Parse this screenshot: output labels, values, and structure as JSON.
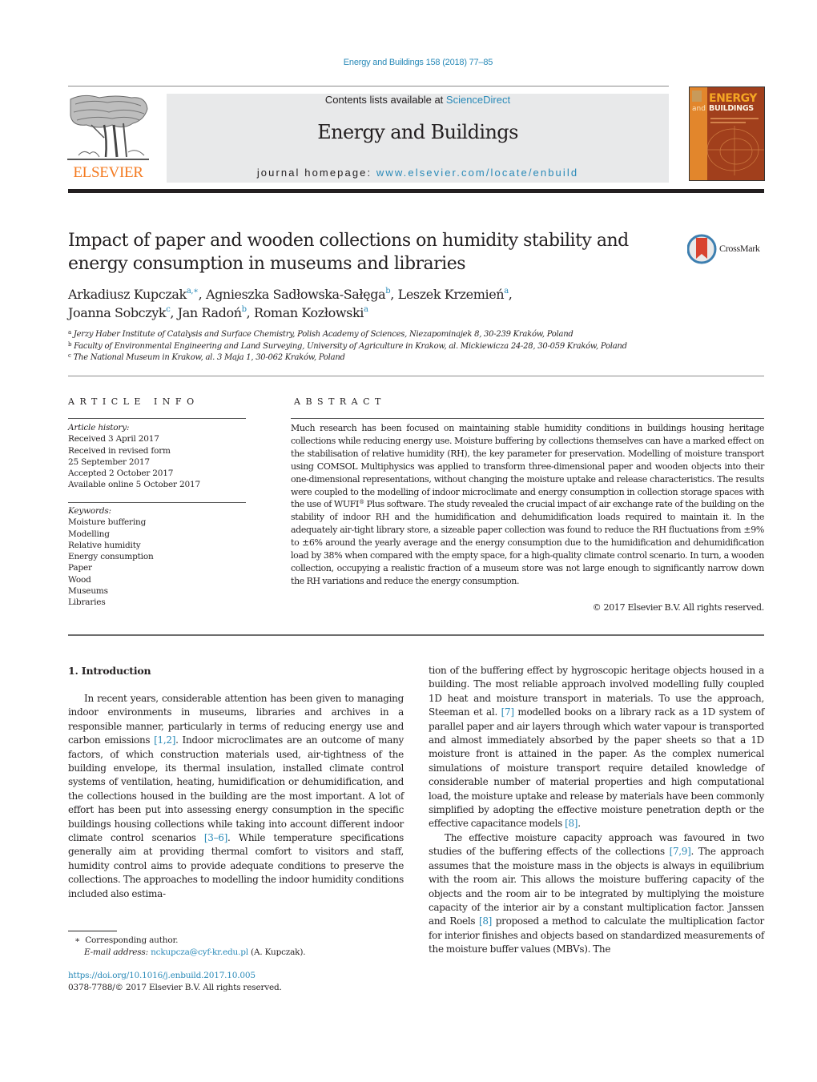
{
  "header": {
    "citation": "Energy and Buildings 158 (2018) 77–85",
    "contents_prefix": "Contents lists available at ",
    "contents_link": "ScienceDirect",
    "journal_name": "Energy and Buildings",
    "homepage_prefix": "journal homepage: ",
    "homepage_link": "www.elsevier.com/locate/enbuild",
    "publisher_wordmark": "ELSEVIER",
    "cover": {
      "line1": "ENERGY",
      "line2_prefix": "and",
      "line2": "BUILDINGS"
    },
    "crossmark_label": "CrossMark"
  },
  "article": {
    "title": "Impact of paper and wooden collections on humidity stability and energy consumption in museums and libraries",
    "authors": [
      {
        "name": "Arkadiusz Kupczak",
        "sup": "a,∗",
        "sep": ", "
      },
      {
        "name": "Agnieszka Sadłowska-Sałęga",
        "sup": "b",
        "sep": ", "
      },
      {
        "name": "Leszek Krzemień",
        "sup": "a",
        "sep": ","
      },
      {
        "name": "Joanna Sobczyk",
        "sup": "c",
        "sep": ", "
      },
      {
        "name": "Jan Radoń",
        "sup": "b",
        "sep": ", "
      },
      {
        "name": "Roman Kozłowski",
        "sup": "a",
        "sep": ""
      }
    ],
    "affiliations": [
      {
        "key": "a",
        "text": "Jerzy Haber Institute of Catalysis and Surface Chemistry, Polish Academy of Sciences, Niezapominajek 8, 30-239 Kraków, Poland"
      },
      {
        "key": "b",
        "text": "Faculty of Environmental Engineering and Land Surveying, University of Agriculture in Krakow, al. Mickiewicza 24-28, 30-059 Kraków, Poland"
      },
      {
        "key": "c",
        "text": "The National Museum in Krakow, al. 3 Maja 1, 30-062 Kraków, Poland"
      }
    ]
  },
  "article_info": {
    "heading": "ARTICLE INFO",
    "history_label": "Article history:",
    "history": [
      "Received 3 April 2017",
      "Received in revised form",
      "25 September 2017",
      "Accepted 2 October 2017",
      "Available online 5 October 2017"
    ],
    "keywords_label": "Keywords:",
    "keywords": [
      "Moisture buffering",
      "Modelling",
      "Relative humidity",
      "Energy consumption",
      "Paper",
      "Wood",
      "Museums",
      "Libraries"
    ]
  },
  "abstract": {
    "heading": "ABSTRACT",
    "text_before_sup": "Much research has been focused on maintaining stable humidity conditions in buildings housing heritage collections while reducing energy use. Moisture buffering by collections themselves can have a marked effect on the stabilisation of relative humidity (RH), the key parameter for preservation. Modelling of moisture transport using COMSOL Multiphysics was applied to transform three-dimensional paper and wooden objects into their one-dimensional representations, without changing the moisture uptake and release characteristics. The results were coupled to the modelling of indoor microclimate and energy consumption in collection storage spaces with the use of WUFI",
    "sup": "®",
    "text_after_sup": " Plus software. The study revealed the crucial impact of air exchange rate of the building on the stability of indoor RH and the humidification and dehumidification loads required to maintain it. In the adequately air-tight library store, a sizeable paper collection was found to reduce the RH fluctuations from ±9% to ±6% around the yearly average and the energy consumption due to the humidification and dehumidification load by 38% when compared with the empty space, for a high-quality climate control scenario. In turn, a wooden collection, occupying a realistic fraction of a museum store was not large enough to significantly narrow down the RH variations and reduce the energy consumption.",
    "copyright": "© 2017 Elsevier B.V. All rights reserved."
  },
  "body": {
    "section_heading": "1.  Introduction",
    "left": {
      "p1_a": "In recent years, considerable attention has been given to managing indoor environments in museums, libraries and archives in a responsible manner, particularly in terms of reducing energy use and carbon emissions ",
      "ref1": "[1,2]",
      "p1_b": ". Indoor microclimates are an outcome of many factors, of which construction materials used, air-tightness of the building envelope, its thermal insulation, installed climate control systems of ventilation, heating, humidification or dehumidification, and the collections housed in the building are the most important. A lot of effort has been put into assessing energy consumption in the specific buildings housing collections while taking into account different indoor climate control scenarios ",
      "ref2": "[3–6]",
      "p1_c": ". While temperature specifications generally aim at providing thermal comfort to visitors and staff, humidity control aims to provide adequate conditions to preserve the collections. The approaches to modelling the indoor humidity conditions included also estima-"
    },
    "right": {
      "p1_a": "tion of the buffering effect by hygroscopic heritage objects housed in a building. The most reliable approach involved modelling fully coupled 1D heat and moisture transport in materials. To use the approach, Steeman et al. ",
      "ref1": "[7]",
      "p1_b": " modelled books on a library rack as a 1D system of parallel paper and air layers through which water vapour is transported and almost immediately absorbed by the paper sheets so that a 1D moisture front is attained in the paper. As the complex numerical simulations of moisture transport require detailed knowledge of considerable number of material properties and high computational load, the moisture uptake and release by materials have been commonly simplified by adopting the effective moisture penetration depth or the effective capacitance models ",
      "ref2": "[8]",
      "p1_c": ".",
      "p2_a": "The effective moisture capacity approach was favoured in two studies of the buffering effects of the collections ",
      "ref3": "[7,9]",
      "p2_b": ". The approach assumes that the moisture mass in the objects is always in equilibrium with the room air. This allows the moisture buffering capacity of the objects and the room air to be integrated by multiplying the moisture capacity of the interior air by a constant multiplication factor. Janssen and Roels ",
      "ref4": "[8]",
      "p2_c": " proposed a method to calculate the multiplication factor for interior finishes and objects based on standardized measurements of the moisture buffer values (MBVs). The"
    }
  },
  "footnote": {
    "marker": "∗",
    "corresponding": "Corresponding author.",
    "email_label": "E-mail address: ",
    "email": "nckupcza@cyf-kr.edu.pl",
    "email_suffix": " (A. Kupczak).",
    "doi": "https://doi.org/10.1016/j.enbuild.2017.10.005",
    "issn_rights": "0378-7788/© 2017 Elsevier B.V. All rights reserved."
  }
}
